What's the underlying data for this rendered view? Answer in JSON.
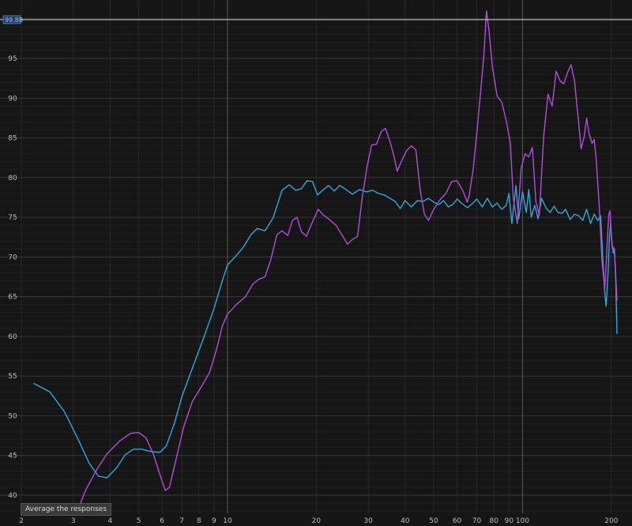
{
  "chart_data": {
    "type": "line",
    "xscale": "log",
    "xlim": [
      2,
      205
    ],
    "ylim": [
      38,
      101
    ],
    "grid": true,
    "x_ticks": [
      {
        "v": 2,
        "label": "2"
      },
      {
        "v": 3,
        "label": "3"
      },
      {
        "v": 4,
        "label": "4"
      },
      {
        "v": 5,
        "label": "5"
      },
      {
        "v": 6,
        "label": "6"
      },
      {
        "v": 7,
        "label": "7"
      },
      {
        "v": 8,
        "label": "8"
      },
      {
        "v": 9,
        "label": "9"
      },
      {
        "v": 10,
        "label": "10"
      },
      {
        "v": 20,
        "label": "20"
      },
      {
        "v": 30,
        "label": "30"
      },
      {
        "v": 40,
        "label": "40"
      },
      {
        "v": 50,
        "label": "50"
      },
      {
        "v": 60,
        "label": "60"
      },
      {
        "v": 70,
        "label": "70"
      },
      {
        "v": 80,
        "label": "80"
      },
      {
        "v": 90,
        "label": "90"
      },
      {
        "v": 100,
        "label": "100"
      },
      {
        "v": 200,
        "label": "200"
      }
    ],
    "y_ticks": [
      {
        "v": 40,
        "label": "40"
      },
      {
        "v": 45,
        "label": "45"
      },
      {
        "v": 50,
        "label": "50"
      },
      {
        "v": 55,
        "label": "55"
      },
      {
        "v": 60,
        "label": "60"
      },
      {
        "v": 65,
        "label": "65"
      },
      {
        "v": 70,
        "label": "70"
      },
      {
        "v": 75,
        "label": "75"
      },
      {
        "v": 80,
        "label": "80"
      },
      {
        "v": 85,
        "label": "85"
      },
      {
        "v": 90,
        "label": "90"
      },
      {
        "v": 95,
        "label": "95"
      }
    ],
    "cursor": {
      "value": 99.88,
      "label": "99.88"
    },
    "series": [
      {
        "color": "#2fa8dc",
        "points": [
          [
            2.2,
            54.1
          ],
          [
            2.5,
            53.0
          ],
          [
            2.8,
            50.5
          ],
          [
            3.1,
            47.2
          ],
          [
            3.4,
            44.0
          ],
          [
            3.65,
            42.4
          ],
          [
            3.9,
            42.2
          ],
          [
            4.2,
            43.4
          ],
          [
            4.5,
            45.1
          ],
          [
            4.8,
            45.8
          ],
          [
            5.1,
            45.8
          ],
          [
            5.5,
            45.5
          ],
          [
            5.9,
            45.4
          ],
          [
            6.2,
            46.2
          ],
          [
            6.6,
            49.0
          ],
          [
            7.0,
            52.4
          ],
          [
            7.6,
            56.0
          ],
          [
            8.3,
            59.8
          ],
          [
            9.0,
            63.5
          ],
          [
            9.6,
            67.0
          ],
          [
            10.0,
            69.0
          ],
          [
            10.6,
            70.0
          ],
          [
            11.3,
            71.2
          ],
          [
            12.0,
            72.8
          ],
          [
            12.6,
            73.6
          ],
          [
            13.4,
            73.3
          ],
          [
            14.3,
            75.0
          ],
          [
            15.3,
            78.4
          ],
          [
            16.2,
            79.1
          ],
          [
            17.0,
            78.4
          ],
          [
            17.8,
            78.6
          ],
          [
            18.6,
            79.6
          ],
          [
            19.4,
            79.5
          ],
          [
            20.2,
            77.8
          ],
          [
            21.0,
            78.4
          ],
          [
            22.0,
            79.0
          ],
          [
            23.0,
            78.3
          ],
          [
            24.0,
            79.0
          ],
          [
            25.0,
            78.6
          ],
          [
            26.5,
            77.9
          ],
          [
            28.0,
            78.5
          ],
          [
            29.5,
            78.2
          ],
          [
            31.0,
            78.4
          ],
          [
            32.5,
            78.0
          ],
          [
            34.0,
            77.8
          ],
          [
            35.5,
            77.4
          ],
          [
            37.0,
            77.0
          ],
          [
            38.5,
            76.1
          ],
          [
            40.0,
            77.1
          ],
          [
            42.0,
            76.3
          ],
          [
            44.0,
            77.1
          ],
          [
            46.0,
            77.0
          ],
          [
            48.0,
            77.4
          ],
          [
            50.0,
            76.9
          ],
          [
            52.0,
            76.6
          ],
          [
            54.0,
            77.1
          ],
          [
            56.0,
            76.3
          ],
          [
            58.0,
            76.6
          ],
          [
            60.0,
            77.3
          ],
          [
            62.0,
            76.8
          ],
          [
            65.0,
            76.2
          ],
          [
            68.0,
            76.8
          ],
          [
            70.0,
            77.3
          ],
          [
            73.0,
            76.3
          ],
          [
            76.0,
            77.4
          ],
          [
            79.0,
            76.3
          ],
          [
            82.0,
            76.8
          ],
          [
            85.0,
            76.0
          ],
          [
            88.0,
            76.5
          ],
          [
            90.0,
            78.0
          ],
          [
            92.0,
            74.2
          ],
          [
            95.0,
            79.0
          ],
          [
            97.0,
            74.8
          ],
          [
            100.0,
            78.2
          ],
          [
            103.0,
            75.6
          ],
          [
            105.0,
            78.5
          ],
          [
            107.0,
            75.0
          ],
          [
            110.0,
            76.5
          ],
          [
            113.0,
            74.8
          ],
          [
            116.0,
            77.4
          ],
          [
            120.0,
            76.2
          ],
          [
            124.0,
            75.6
          ],
          [
            128.0,
            76.4
          ],
          [
            132.0,
            75.6
          ],
          [
            136.0,
            75.5
          ],
          [
            140.0,
            76.0
          ],
          [
            145.0,
            74.7
          ],
          [
            150.0,
            75.4
          ],
          [
            155.0,
            75.2
          ],
          [
            160.0,
            74.6
          ],
          [
            165.0,
            76.0
          ],
          [
            170.0,
            74.2
          ],
          [
            175.0,
            75.4
          ],
          [
            180.0,
            74.6
          ],
          [
            184.0,
            75.2
          ],
          [
            187.0,
            70.0
          ],
          [
            190.0,
            65.5
          ],
          [
            192.0,
            63.8
          ],
          [
            195.0,
            68.0
          ],
          [
            197.0,
            72.5
          ],
          [
            199.0,
            74.2
          ],
          [
            201.0,
            72.0
          ],
          [
            203.0,
            70.5
          ],
          [
            205.0,
            71.0
          ],
          [
            207.0,
            67.0
          ],
          [
            209.0,
            60.3
          ]
        ]
      },
      {
        "color": "#b24fd8",
        "points": [
          [
            3.1,
            38.0
          ],
          [
            3.3,
            40.6
          ],
          [
            3.6,
            43.2
          ],
          [
            3.9,
            45.2
          ],
          [
            4.3,
            46.8
          ],
          [
            4.7,
            47.8
          ],
          [
            5.0,
            47.9
          ],
          [
            5.3,
            47.2
          ],
          [
            5.6,
            45.2
          ],
          [
            5.9,
            42.6
          ],
          [
            6.15,
            40.6
          ],
          [
            6.35,
            41.0
          ],
          [
            6.7,
            44.6
          ],
          [
            7.1,
            48.6
          ],
          [
            7.6,
            51.8
          ],
          [
            8.2,
            53.8
          ],
          [
            8.7,
            55.5
          ],
          [
            9.2,
            58.5
          ],
          [
            9.6,
            61.3
          ],
          [
            10.0,
            62.8
          ],
          [
            10.7,
            64.0
          ],
          [
            11.5,
            65.0
          ],
          [
            12.2,
            66.6
          ],
          [
            12.8,
            67.2
          ],
          [
            13.4,
            67.5
          ],
          [
            14.0,
            69.6
          ],
          [
            14.7,
            72.8
          ],
          [
            15.3,
            73.3
          ],
          [
            16.0,
            72.7
          ],
          [
            16.6,
            74.6
          ],
          [
            17.2,
            75.0
          ],
          [
            17.8,
            73.2
          ],
          [
            18.5,
            72.6
          ],
          [
            19.3,
            74.2
          ],
          [
            20.3,
            76.0
          ],
          [
            21.1,
            75.3
          ],
          [
            22.0,
            74.8
          ],
          [
            23.3,
            74.0
          ],
          [
            24.6,
            72.6
          ],
          [
            25.5,
            71.6
          ],
          [
            26.5,
            72.2
          ],
          [
            27.6,
            72.6
          ],
          [
            28.6,
            77.4
          ],
          [
            29.7,
            81.3
          ],
          [
            30.8,
            84.1
          ],
          [
            32.0,
            84.2
          ],
          [
            33.2,
            85.8
          ],
          [
            34.3,
            86.2
          ],
          [
            35.5,
            84.6
          ],
          [
            36.6,
            82.8
          ],
          [
            37.6,
            80.8
          ],
          [
            38.8,
            82.0
          ],
          [
            40.5,
            83.4
          ],
          [
            42.0,
            84.0
          ],
          [
            43.5,
            83.5
          ],
          [
            45.0,
            78.4
          ],
          [
            46.5,
            75.4
          ],
          [
            48.0,
            74.6
          ],
          [
            50.0,
            76.0
          ],
          [
            52.5,
            77.2
          ],
          [
            55.0,
            78.0
          ],
          [
            57.5,
            79.5
          ],
          [
            60.0,
            79.6
          ],
          [
            63.0,
            78.2
          ],
          [
            65.0,
            76.9
          ],
          [
            66.0,
            77.8
          ],
          [
            68.0,
            81.0
          ],
          [
            70.0,
            85.6
          ],
          [
            72.0,
            90.5
          ],
          [
            74.0,
            95.5
          ],
          [
            75.5,
            101.0
          ],
          [
            77.0,
            98.5
          ],
          [
            79.0,
            94.0
          ],
          [
            82.0,
            90.3
          ],
          [
            85.0,
            89.5
          ],
          [
            88.0,
            87.2
          ],
          [
            91.0,
            84.3
          ],
          [
            93.0,
            77.5
          ],
          [
            96.0,
            74.2
          ],
          [
            99.0,
            81.2
          ],
          [
            102.0,
            83.0
          ],
          [
            105.0,
            82.6
          ],
          [
            108.0,
            83.8
          ],
          [
            111.0,
            77.0
          ],
          [
            114.0,
            75.3
          ],
          [
            118.0,
            85.2
          ],
          [
            122.0,
            90.5
          ],
          [
            126.0,
            89.0
          ],
          [
            130.0,
            93.4
          ],
          [
            134.0,
            92.2
          ],
          [
            138.0,
            91.8
          ],
          [
            142.0,
            93.2
          ],
          [
            146.0,
            94.2
          ],
          [
            150.0,
            92.2
          ],
          [
            154.0,
            88.0
          ],
          [
            158.0,
            83.6
          ],
          [
            162.0,
            85.2
          ],
          [
            165.0,
            87.5
          ],
          [
            168.0,
            85.6
          ],
          [
            172.0,
            84.3
          ],
          [
            175.0,
            84.8
          ],
          [
            178.0,
            82.0
          ],
          [
            182.0,
            76.5
          ],
          [
            186.0,
            69.5
          ],
          [
            190.0,
            66.0
          ],
          [
            193.0,
            70.5
          ],
          [
            196.0,
            75.3
          ],
          [
            198.0,
            75.8
          ],
          [
            200.0,
            72.4
          ],
          [
            202.0,
            71.0
          ],
          [
            204.0,
            71.2
          ],
          [
            206.0,
            69.4
          ],
          [
            209.0,
            64.5
          ]
        ]
      }
    ]
  },
  "tooltip": {
    "text": "Average the responses"
  },
  "colors": {
    "background": "#161616",
    "grid": "#2e2e2e",
    "major_grid": "#5a5a5a",
    "cursor": "#d0d0d0"
  }
}
